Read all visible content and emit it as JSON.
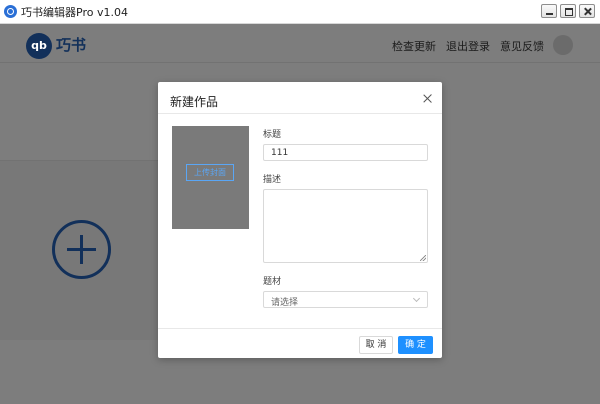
{
  "window": {
    "title": "巧书编辑器Pro v1.04",
    "controls": [
      "minimize",
      "maximize",
      "close"
    ]
  },
  "header": {
    "logo_text": "qb",
    "brand": "巧书",
    "nav": [
      "检查更新",
      "退出登录",
      "意见反馈"
    ]
  },
  "dialog": {
    "title": "新建作品",
    "upload_label": "上传封面",
    "fields": {
      "title_label": "标题",
      "title_value": "111",
      "desc_label": "描述",
      "desc_value": "",
      "theme_label": "题材",
      "theme_placeholder": "请选择"
    },
    "buttons": {
      "cancel": "取 消",
      "ok": "确 定"
    }
  },
  "colors": {
    "overlay_bg": "#7d7d7d",
    "brand": "#12305a",
    "primary": "#1e90ff",
    "upload_accent": "#5aa6f5"
  }
}
